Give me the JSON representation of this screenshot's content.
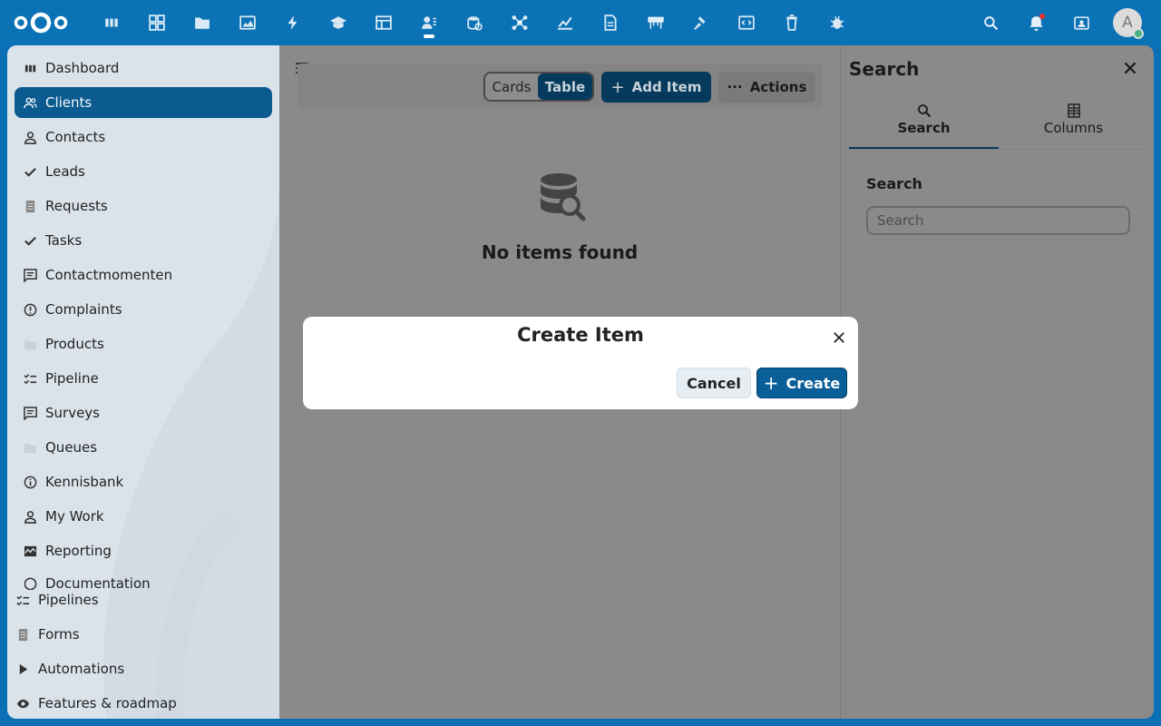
{
  "header": {
    "apps": [
      "dashboard-icon",
      "apps-icon",
      "files-icon",
      "photos-icon",
      "activity-icon",
      "learn-icon",
      "tables-icon",
      "contacts-icon",
      "database-icon",
      "network-icon",
      "analytics-icon",
      "document-icon",
      "deck-icon",
      "hammer-icon",
      "code-icon",
      "trash-icon",
      "bug-icon"
    ],
    "right_icons": [
      "search-icon",
      "bell-icon",
      "contacts-menu-icon"
    ],
    "avatar_letter": "A"
  },
  "sidebar": {
    "items": [
      {
        "label": "Dashboard",
        "icon": "dashboard-icon"
      },
      {
        "label": "Clients",
        "icon": "clients-icon"
      },
      {
        "label": "Contacts",
        "icon": "person-icon"
      },
      {
        "label": "Leads",
        "icon": "check-icon"
      },
      {
        "label": "Requests",
        "icon": "file-icon"
      },
      {
        "label": "Tasks",
        "icon": "check-icon"
      },
      {
        "label": "Contactmomenten",
        "icon": "chat-icon"
      },
      {
        "label": "Complaints",
        "icon": "alert-icon"
      },
      {
        "label": "Products",
        "icon": "folder-icon"
      },
      {
        "label": "Pipeline",
        "icon": "checklist-icon"
      },
      {
        "label": "Surveys",
        "icon": "chat-icon"
      },
      {
        "label": "Queues",
        "icon": "folder-icon"
      },
      {
        "label": "Kennisbank",
        "icon": "info-icon"
      },
      {
        "label": "My Work",
        "icon": "person-icon"
      },
      {
        "label": "Reporting",
        "icon": "chart-icon"
      },
      {
        "label": "Documentation",
        "icon": "alert-icon"
      }
    ],
    "active_index": 1,
    "bottom": [
      {
        "label": "Pipelines",
        "icon": "checklist-icon"
      },
      {
        "label": "Forms",
        "icon": "file-icon"
      },
      {
        "label": "Automations",
        "icon": "play-icon"
      },
      {
        "label": "Features & roadmap",
        "icon": "eye-icon"
      }
    ]
  },
  "toolbar": {
    "view_cards": "Cards",
    "view_table": "Table",
    "add_item": "Add Item",
    "actions": "Actions"
  },
  "empty_state": {
    "title": "No items found"
  },
  "side_panel": {
    "title": "Search",
    "tabs": [
      {
        "label": "Search",
        "icon": "search-icon"
      },
      {
        "label": "Columns",
        "icon": "columns-icon"
      }
    ],
    "section_label": "Search",
    "search_placeholder": "Search"
  },
  "modal": {
    "title": "Create Item",
    "cancel_label": "Cancel",
    "create_label": "Create"
  },
  "colors": {
    "header_bg": "#0b72b6",
    "primary": "#0b5f99",
    "active_nav": "#0b5a90"
  }
}
